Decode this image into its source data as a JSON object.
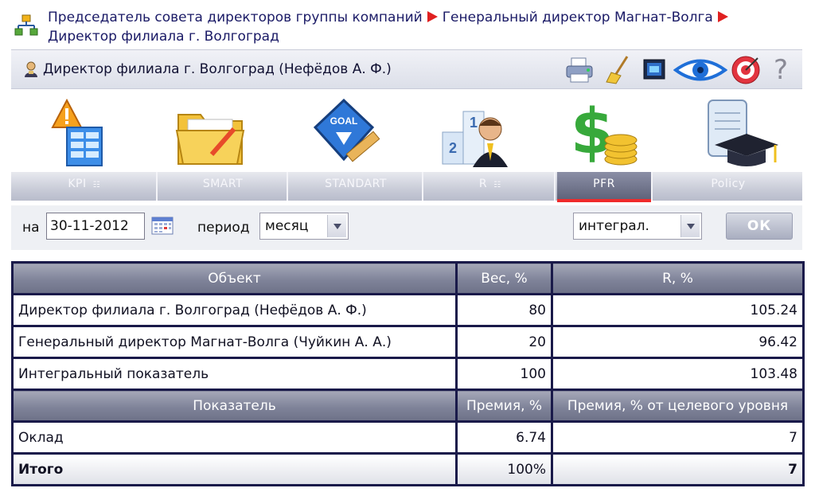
{
  "breadcrumb": {
    "items": [
      "Председатель совета директоров группы компаний",
      "Генеральный директор Магнат-Волга",
      "Директор филиала г. Волгоград"
    ]
  },
  "header": {
    "title": "Директор филиала г. Волгоград  (Нефёдов А. Ф.)",
    "tools": [
      "printer-icon",
      "broom-icon",
      "screen-icon",
      "eye-icon",
      "target-icon",
      "help-icon"
    ],
    "help_symbol": "?"
  },
  "modules": {
    "icons": [
      "kpi-icon",
      "smart-folder-icon",
      "goal-standart-icon",
      "rating-podium-icon",
      "dollar-coins-icon",
      "policy-scroll-icon"
    ],
    "tabs": [
      {
        "label": "KPI",
        "sub": "☷"
      },
      {
        "label": "SMART",
        "sub": ""
      },
      {
        "label": "STANDART",
        "sub": ""
      },
      {
        "label": "R",
        "sub": "☷"
      },
      {
        "label": "PFR",
        "sub": ""
      },
      {
        "label": "Policy",
        "sub": ""
      }
    ],
    "active_tab": "PFR"
  },
  "filters": {
    "date_label": "на",
    "date_value": "30-11-2012",
    "period_label": "период",
    "period_value": "месяц",
    "mode_value": "интеграл.",
    "ok_label": "ОК"
  },
  "table": {
    "header1": [
      "Объект",
      "Вес, %",
      "R, %"
    ],
    "rows1": [
      [
        "Директор филиала г. Волгоград (Нефёдов А. Ф.)",
        "80",
        "105.24"
      ],
      [
        "Генеральный директор Магнат-Волга (Чуйкин А. А.)",
        "20",
        "96.42"
      ],
      [
        "Интегральный показатель",
        "100",
        "103.48"
      ]
    ],
    "header2": [
      "Показатель",
      "Премия, %",
      "Премия, % от целевого уровня"
    ],
    "rows2": [
      [
        "Оклад",
        "6.74",
        "7"
      ]
    ],
    "total": [
      "Итого",
      "100%",
      "7"
    ]
  },
  "colors": {
    "accent_red": "#ef2b2b",
    "header_gray": "#7f8399",
    "border_navy": "#1a1a4a",
    "link_blue": "#1a1a66"
  }
}
